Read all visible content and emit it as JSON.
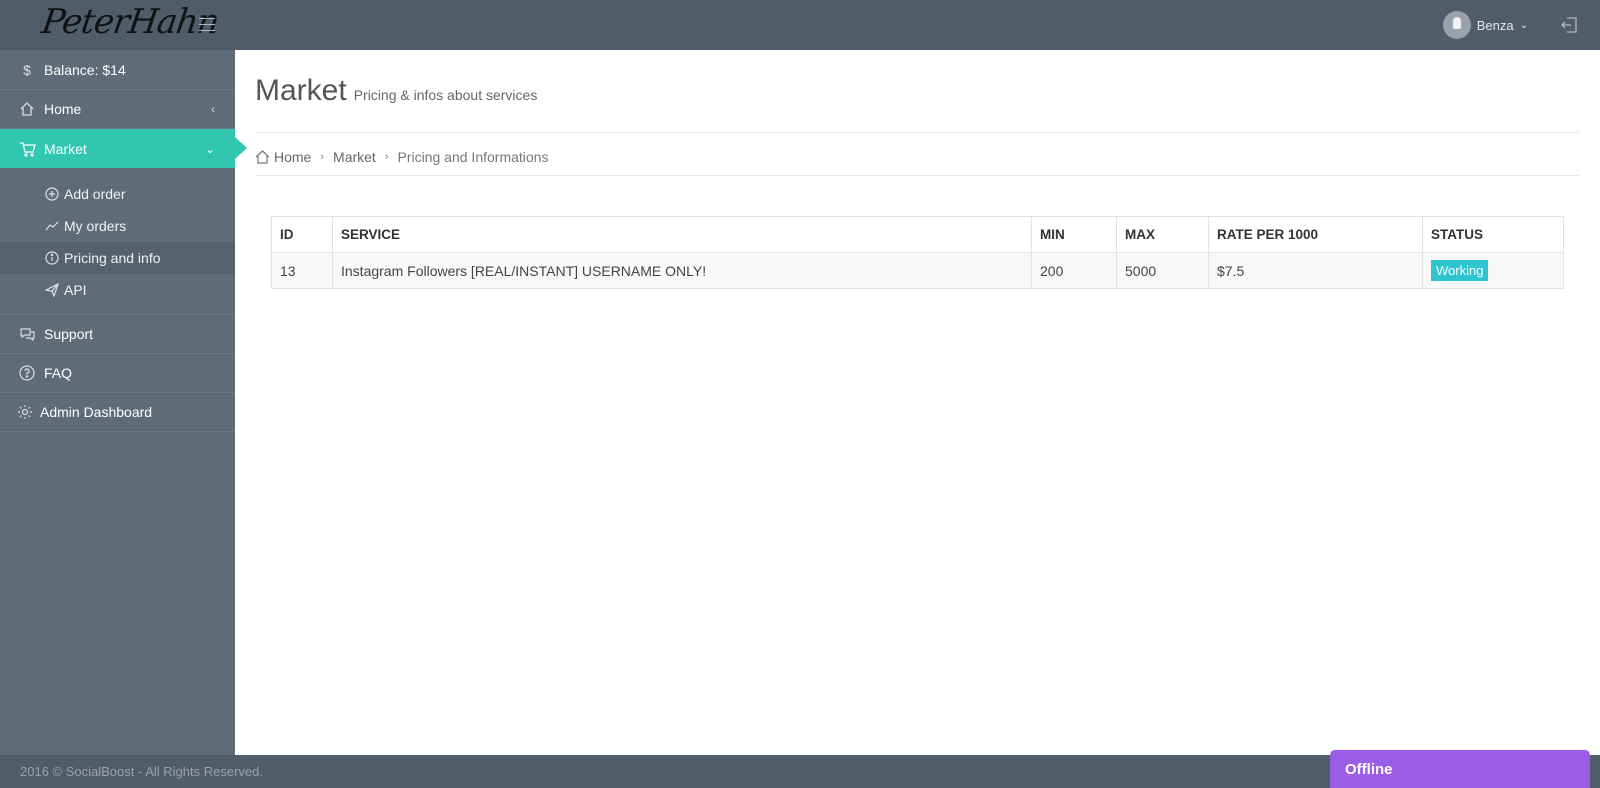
{
  "header": {
    "logo_text": "PeterHahn",
    "user_name": "Benza"
  },
  "sidebar": {
    "balance_label": "Balance: $14",
    "items": [
      {
        "label": "Home"
      },
      {
        "label": "Market"
      },
      {
        "label": "Support"
      },
      {
        "label": "FAQ"
      },
      {
        "label": "Admin Dashboard"
      }
    ],
    "market_sub": [
      {
        "label": "Add order"
      },
      {
        "label": "My orders"
      },
      {
        "label": "Pricing and info"
      },
      {
        "label": "API"
      }
    ]
  },
  "page": {
    "title": "Market",
    "subtitle": "Pricing & infos about services"
  },
  "breadcrumb": {
    "home": "Home",
    "market": "Market",
    "current": "Pricing and Informations"
  },
  "table": {
    "headers": [
      "ID",
      "SERVICE",
      "MIN",
      "MAX",
      "RATE PER 1000",
      "STATUS"
    ],
    "rows": [
      {
        "id": "13",
        "service": "Instagram Followers [REAL/INSTANT] USERNAME ONLY!",
        "min": "200",
        "max": "5000",
        "rate": "$7.5",
        "status": "Working"
      }
    ]
  },
  "footer": {
    "copyright": "2016 © SocialBoost - All Rights Reserved."
  },
  "chat": {
    "status": "Offline"
  },
  "colors": {
    "topbar": "#515c6a",
    "sidebar": "#606b78",
    "accent": "#31c6b0",
    "status_badge": "#2ec4d0",
    "chat": "#9b5de5"
  },
  "icons": {
    "balance": "dollar-icon",
    "home": "home-icon",
    "market": "cart-icon",
    "add_order": "plus-circle-icon",
    "my_orders": "trend-line-icon",
    "pricing": "info-circle-icon",
    "api": "paper-plane-icon",
    "support": "chat-bubbles-icon",
    "faq": "question-circle-icon",
    "admin": "gear-icon",
    "logout": "logout-icon"
  }
}
